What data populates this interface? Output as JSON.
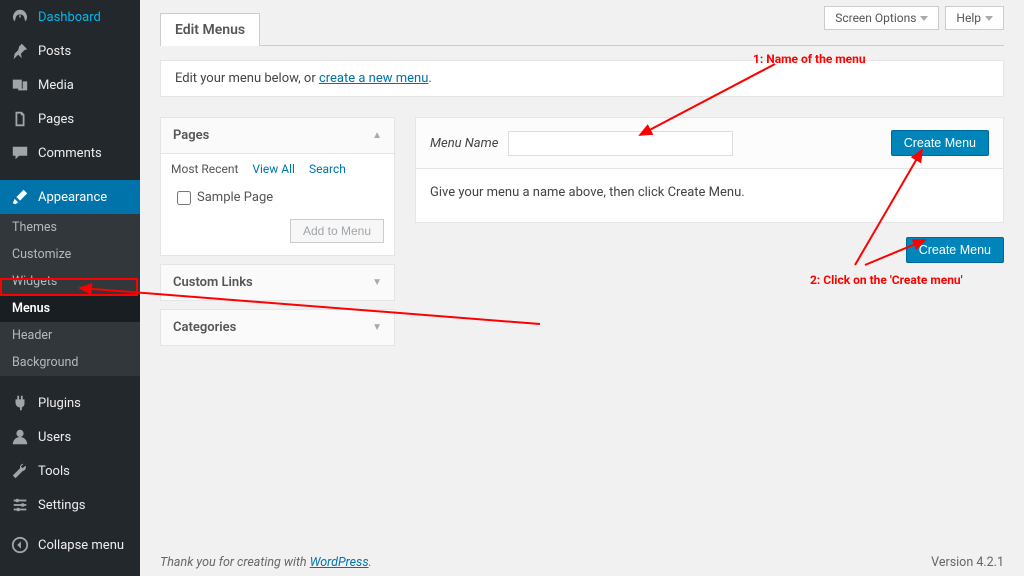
{
  "top": {
    "screen_options": "Screen Options",
    "help": "Help"
  },
  "sidebar": {
    "dashboard": "Dashboard",
    "posts": "Posts",
    "media": "Media",
    "pages": "Pages",
    "comments": "Comments",
    "appearance": "Appearance",
    "appearance_sub": {
      "themes": "Themes",
      "customize": "Customize",
      "widgets": "Widgets",
      "menus": "Menus",
      "header": "Header",
      "background": "Background"
    },
    "plugins": "Plugins",
    "users": "Users",
    "tools": "Tools",
    "settings": "Settings",
    "collapse": "Collapse menu"
  },
  "tab": {
    "edit_menus": "Edit Menus"
  },
  "notice": {
    "pre": "Edit your menu below, or ",
    "link": "create a new menu",
    "post": "."
  },
  "meta": {
    "pages": {
      "title": "Pages",
      "tab_recent": "Most Recent",
      "tab_viewall": "View All",
      "tab_search": "Search",
      "item_sample": "Sample Page",
      "add": "Add to Menu"
    },
    "custom_links": "Custom Links",
    "categories": "Categories"
  },
  "editor": {
    "menu_name_label": "Menu Name",
    "menu_name_value": "",
    "hint": "Give your menu a name above, then click Create Menu.",
    "create": "Create Menu"
  },
  "annotations": {
    "a1": "1: Name of the menu",
    "a2": "2: Click on the 'Create menu'"
  },
  "footer": {
    "thank_pre": "Thank you for creating with ",
    "thank_link": "WordPress",
    "thank_post": ".",
    "version": "Version 4.2.1"
  }
}
